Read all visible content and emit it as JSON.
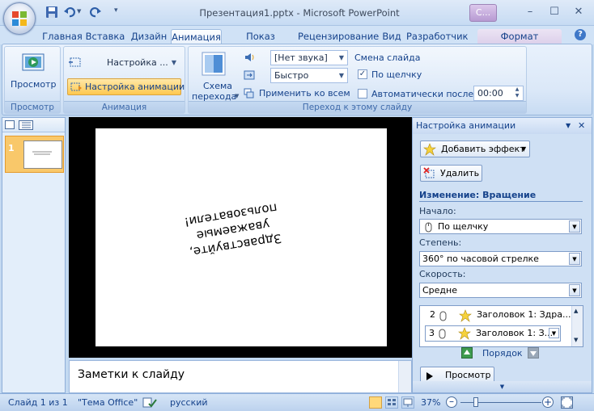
{
  "window": {
    "title": "Презентация1.pptx - Microsoft PowerPoint",
    "context_tab": "С...",
    "minimize": "–",
    "maximize": "☐",
    "close": "✕"
  },
  "quick_access": [
    "save-icon",
    "undo-icon",
    "redo-icon",
    "customize-icon"
  ],
  "tabs": [
    "Главная",
    "Вставка",
    "Дизайн",
    "Анимация",
    "Показ слайдов",
    "Рецензирование",
    "Вид",
    "Разработчик",
    "Формат"
  ],
  "active_tab": "Анимация",
  "ribbon": {
    "preview": {
      "button": "Просмотр",
      "group": "Просмотр"
    },
    "animation": {
      "animate_value": "Настройка ...",
      "custom_button": "Настройка анимации",
      "group": "Анимация"
    },
    "transition": {
      "scheme_line1": "Схема",
      "scheme_line2": "перехода",
      "sound": "[Нет звука]",
      "speed": "Быстро",
      "apply_all": "Применить ко всем",
      "advance_title": "Смена слайда",
      "on_click": "По щелчку",
      "on_click_checked": true,
      "auto_after": "Автоматически после:",
      "auto_checked": false,
      "time": "00:00",
      "group": "Переход к этому слайду"
    }
  },
  "slides_pane": {
    "slide_number": "1"
  },
  "slide": {
    "text_line1": "Здравствуйте, уважаемые",
    "text_line2": "пользователи!"
  },
  "notes": {
    "placeholder": "Заметки к слайду"
  },
  "task_pane": {
    "title": "Настройка анимации",
    "add_effect": "Добавить эффект",
    "remove": "Удалить",
    "section": "Изменение: Вращение",
    "start_label": "Начало:",
    "start_value": "По щелчку",
    "amount_label": "Степень:",
    "amount_value": "360° по часовой стрелке",
    "speed_label": "Скорость:",
    "speed_value": "Средне",
    "list": [
      {
        "num": "2",
        "text": "Заголовок 1: Здра..."
      },
      {
        "num": "3",
        "text": "Заголовок 1: З..."
      }
    ],
    "reorder": "Порядок",
    "play": "Просмотр"
  },
  "status": {
    "slide": "Слайд 1 из 1",
    "theme": "\"Тема Office\"",
    "language": "русский",
    "zoom": "37%",
    "zoom_level": 0.37
  },
  "colors": {
    "accent": "#15428b",
    "selection": "#f9c86a",
    "ribbon": "#dbe8f8"
  }
}
